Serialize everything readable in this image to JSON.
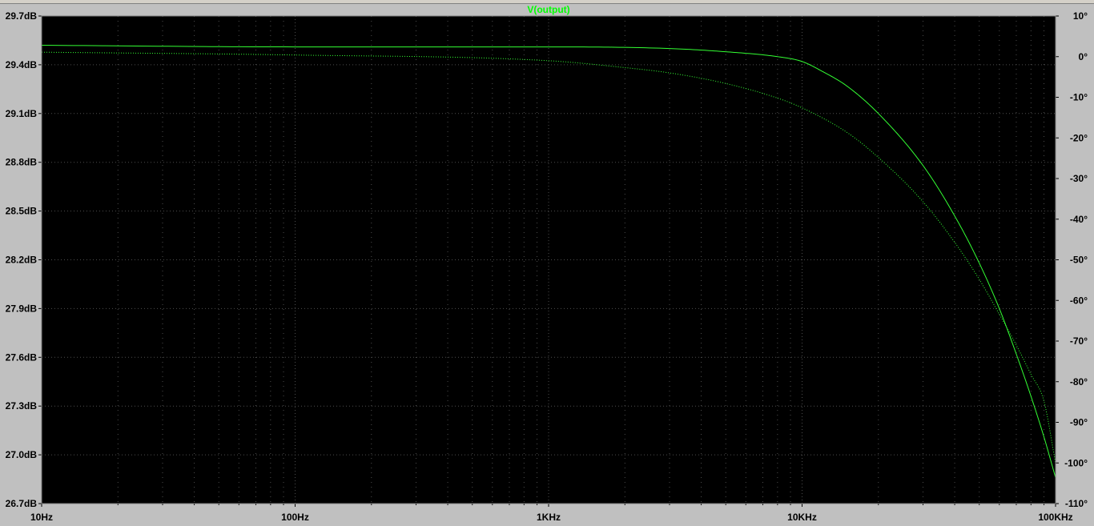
{
  "colors": {
    "plot_background": "#000000",
    "frame_background": "#c0c0c0",
    "trace": "#33ff33",
    "title": "#00ff00",
    "grid": "#4d4d4d",
    "axis_text": "#000000"
  },
  "chart_data": {
    "type": "line",
    "title": "V(output)",
    "xscale": "log",
    "xlim": [
      10,
      100000
    ],
    "xticks": [
      {
        "value": 10,
        "label": "10Hz"
      },
      {
        "value": 100,
        "label": "100Hz"
      },
      {
        "value": 1000,
        "label": "1KHz"
      },
      {
        "value": 10000,
        "label": "10KHz"
      },
      {
        "value": 100000,
        "label": "100KHz"
      }
    ],
    "y_left": {
      "unit": "dB",
      "lim": [
        26.7,
        29.7
      ],
      "ticks": [
        {
          "value": 29.7,
          "label": "29.7dB"
        },
        {
          "value": 29.4,
          "label": "29.4dB"
        },
        {
          "value": 29.1,
          "label": "29.1dB"
        },
        {
          "value": 28.8,
          "label": "28.8dB"
        },
        {
          "value": 28.5,
          "label": "28.5dB"
        },
        {
          "value": 28.2,
          "label": "28.2dB"
        },
        {
          "value": 27.9,
          "label": "27.9dB"
        },
        {
          "value": 27.6,
          "label": "27.6dB"
        },
        {
          "value": 27.3,
          "label": "27.3dB"
        },
        {
          "value": 27.0,
          "label": "27.0dB"
        },
        {
          "value": 26.7,
          "label": "26.7dB"
        }
      ]
    },
    "y_right": {
      "unit": "degrees",
      "lim": [
        -110,
        10
      ],
      "ticks": [
        {
          "value": 10,
          "label": "10°"
        },
        {
          "value": 0,
          "label": "0°"
        },
        {
          "value": -10,
          "label": "-10°"
        },
        {
          "value": -20,
          "label": "-20°"
        },
        {
          "value": -30,
          "label": "-30°"
        },
        {
          "value": -40,
          "label": "-40°"
        },
        {
          "value": -50,
          "label": "-50°"
        },
        {
          "value": -60,
          "label": "-60°"
        },
        {
          "value": -70,
          "label": "-70°"
        },
        {
          "value": -80,
          "label": "-80°"
        },
        {
          "value": -90,
          "label": "-90°"
        },
        {
          "value": -100,
          "label": "-100°"
        },
        {
          "value": -110,
          "label": "-110°"
        }
      ]
    },
    "grid": true,
    "series": [
      {
        "axis": "left",
        "style": "solid",
        "x": [
          10,
          100,
          1000,
          3000,
          5000,
          8000,
          10000,
          12000,
          15000,
          20000,
          30000,
          40000,
          50000,
          60000,
          70000,
          80000,
          90000,
          100000
        ],
        "y": [
          29.52,
          29.51,
          29.51,
          29.5,
          29.48,
          29.45,
          29.42,
          29.36,
          29.27,
          29.1,
          28.78,
          28.47,
          28.18,
          27.9,
          27.62,
          27.36,
          27.11,
          26.86
        ]
      },
      {
        "axis": "right",
        "style": "dotted",
        "x": [
          10,
          100,
          1000,
          2000,
          3000,
          5000,
          8000,
          10000,
          15000,
          20000,
          30000,
          40000,
          50000,
          60000,
          70000,
          80000,
          90000,
          100000
        ],
        "y": [
          1.1,
          0.4,
          -1.0,
          -2.7,
          -4.0,
          -6.6,
          -10.2,
          -12.6,
          -18.6,
          -24.8,
          -35.7,
          -45.7,
          -54.8,
          -63.4,
          -71.0,
          -78.2,
          -84.8,
          -100.0
        ]
      }
    ]
  }
}
